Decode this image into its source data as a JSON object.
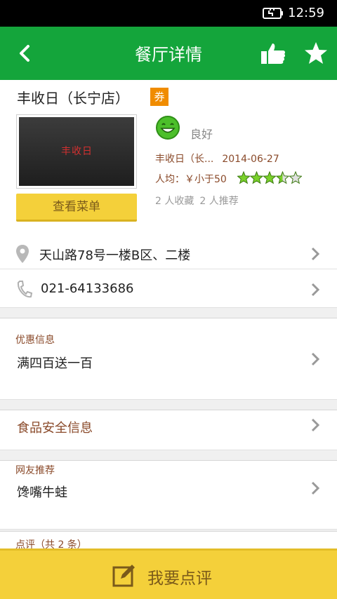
{
  "status_bar": {
    "time": "12:59"
  },
  "app_bar": {
    "title": "餐厅详情"
  },
  "restaurant": {
    "name": "丰收日（长宁店）",
    "coupon_badge": "券",
    "photo_sign_text": "丰收日",
    "menu_button": "查看菜单",
    "rating_word": "良好",
    "short_name": "丰收日（长...",
    "date": "2014-06-27",
    "avg_price": "人均：￥小于50",
    "star_rating": 3.5,
    "favorites": "2 人收藏",
    "recommends": "2 人推荐"
  },
  "address": {
    "text": "天山路78号一楼B区、二楼"
  },
  "phone": {
    "text": "021-64133686"
  },
  "promo": {
    "label": "优惠信息",
    "value": "满四百送一百"
  },
  "safety": {
    "label": "食品安全信息"
  },
  "recommend": {
    "label": "网友推荐",
    "value": "馋嘴牛蛙"
  },
  "reviews": {
    "label": "点评（共 2 条）"
  },
  "bottom_action": {
    "label": "我要点评"
  },
  "colors": {
    "brand_green": "#14a53b",
    "accent_yellow": "#f4d03a",
    "coupon_orange": "#f08c00",
    "label_brown": "#8a4a2a"
  }
}
